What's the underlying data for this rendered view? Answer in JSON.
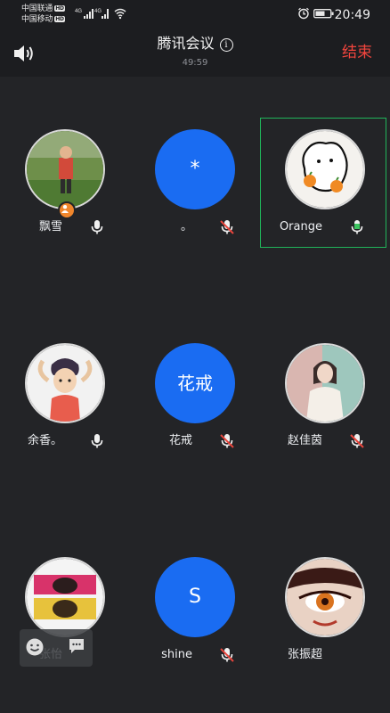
{
  "status_bar": {
    "carrier_1": "中国联通",
    "carrier_2": "中国移动",
    "hd_label": "HD",
    "network_1": "4G",
    "network_2": "4G",
    "time": "20:49"
  },
  "header": {
    "title": "腾讯会议",
    "info_glyph": "i",
    "timer": "49:59",
    "end_label": "结束"
  },
  "participants": [
    {
      "name": "飘雪",
      "mic": "on",
      "avatar": "photo"
    },
    {
      "name": "。",
      "mic": "muted",
      "avatar": "initial",
      "initial": "*"
    },
    {
      "name": "Orange",
      "mic": "speaking",
      "avatar": "photo",
      "active": true
    },
    {
      "name": "余香。",
      "mic": "on",
      "avatar": "photo"
    },
    {
      "name": "花戒",
      "mic": "muted",
      "avatar": "initial",
      "initial": "花戒"
    },
    {
      "name": "赵佳茵",
      "mic": "muted",
      "avatar": "photo"
    },
    {
      "name": "张怡",
      "mic": "none",
      "avatar": "photo"
    },
    {
      "name": "shine",
      "mic": "muted",
      "avatar": "initial",
      "initial": "S"
    },
    {
      "name": "张振超",
      "mic": "none",
      "avatar": "photo"
    }
  ],
  "colors": {
    "background": "#232427",
    "avatar_blue": "#1a6cf2",
    "end_red": "#f2453d",
    "speaking_green": "#20b45a",
    "muted_red": "#e8453c"
  }
}
